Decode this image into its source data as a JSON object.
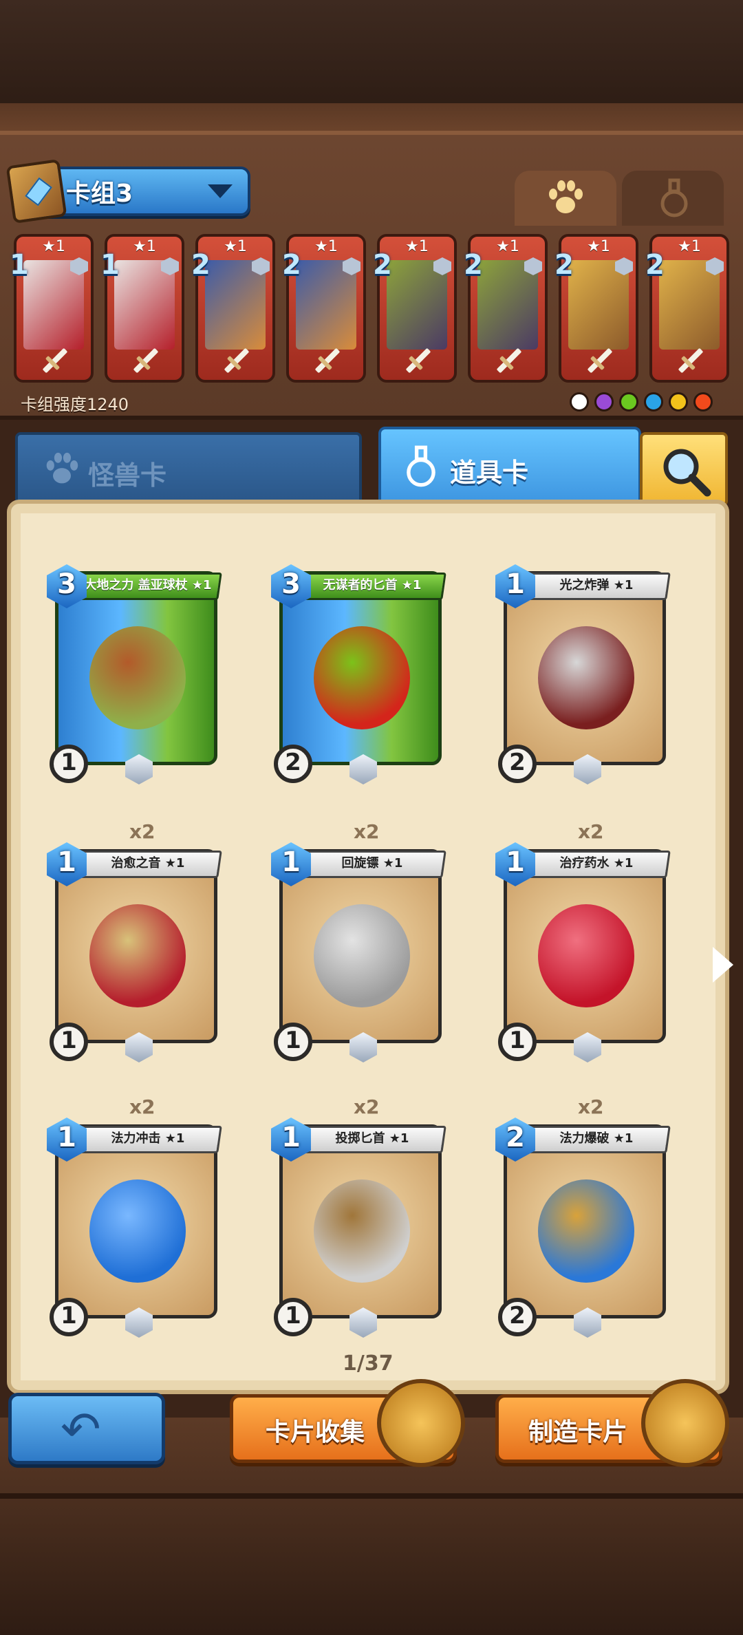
{
  "deck": {
    "name": "卡组3",
    "strength": "卡组强度1240"
  },
  "deck_slots": [
    {
      "cost": "1",
      "star": "★1",
      "colors": [
        "#e9e4e2",
        "#b51f2a"
      ]
    },
    {
      "cost": "1",
      "star": "★1",
      "colors": [
        "#e9e4e2",
        "#b51f2a"
      ]
    },
    {
      "cost": "2",
      "star": "★1",
      "colors": [
        "#3d5ca8",
        "#d98c3a"
      ]
    },
    {
      "cost": "2",
      "star": "★1",
      "colors": [
        "#3d5ca8",
        "#d98c3a"
      ]
    },
    {
      "cost": "2",
      "star": "★1",
      "colors": [
        "#8da33b",
        "#4b3a64"
      ]
    },
    {
      "cost": "2",
      "star": "★1",
      "colors": [
        "#8da33b",
        "#4b3a64"
      ]
    },
    {
      "cost": "2",
      "star": "★1",
      "colors": [
        "#e0b24a",
        "#8d5b2b"
      ]
    },
    {
      "cost": "2",
      "star": "★1",
      "colors": [
        "#e0b24a",
        "#8d5b2b"
      ]
    }
  ],
  "element_icons": [
    "neutral-icon",
    "purple-element-icon",
    "green-element-icon",
    "water-icon",
    "lightning-icon",
    "fire-icon"
  ],
  "element_colors": [
    "#ffffff",
    "#9a4bd6",
    "#6bc820",
    "#2aa3e8",
    "#f3c21b",
    "#f24a1c"
  ],
  "category_tabs": {
    "monster": "怪兽卡",
    "item": "道具卡"
  },
  "cards": [
    {
      "cost": "3",
      "name": "大地之力 盖亚球杖 ★1",
      "level": "1",
      "copies": "",
      "art": [
        "#8fb04a",
        "#b35a2a"
      ]
    },
    {
      "cost": "3",
      "name": "无谋者的匕首 ★1",
      "level": "2",
      "copies": "",
      "art": [
        "#d4251b",
        "#7cc21a"
      ]
    },
    {
      "cost": "1",
      "name": "光之炸弹 ★1",
      "level": "2",
      "copies": "",
      "art": [
        "#7a1f1f",
        "#d7d7d7"
      ]
    },
    {
      "cost": "1",
      "name": "治愈之音 ★1",
      "level": "1",
      "copies": "x2",
      "art": [
        "#b51e2d",
        "#d8c27a"
      ]
    },
    {
      "cost": "1",
      "name": "回旋镖 ★1",
      "level": "1",
      "copies": "x2",
      "art": [
        "#9c9c9c",
        "#e3e3e3"
      ]
    },
    {
      "cost": "1",
      "name": "治疗药水 ★1",
      "level": "1",
      "copies": "x2",
      "art": [
        "#c4142a",
        "#f07080"
      ]
    },
    {
      "cost": "1",
      "name": "法力冲击 ★1",
      "level": "1",
      "copies": "x2",
      "art": [
        "#1f6fd6",
        "#7ab8ff"
      ]
    },
    {
      "cost": "1",
      "name": "投掷匕首 ★1",
      "level": "1",
      "copies": "x2",
      "art": [
        "#d0d0d0",
        "#a0763a"
      ]
    },
    {
      "cost": "2",
      "name": "法力爆破 ★1",
      "level": "2",
      "copies": "x2",
      "art": [
        "#2a78d8",
        "#d9a23a"
      ]
    }
  ],
  "pagination": "1/37",
  "buttons": {
    "collection": "卡片收集",
    "craft": "制造卡片"
  }
}
